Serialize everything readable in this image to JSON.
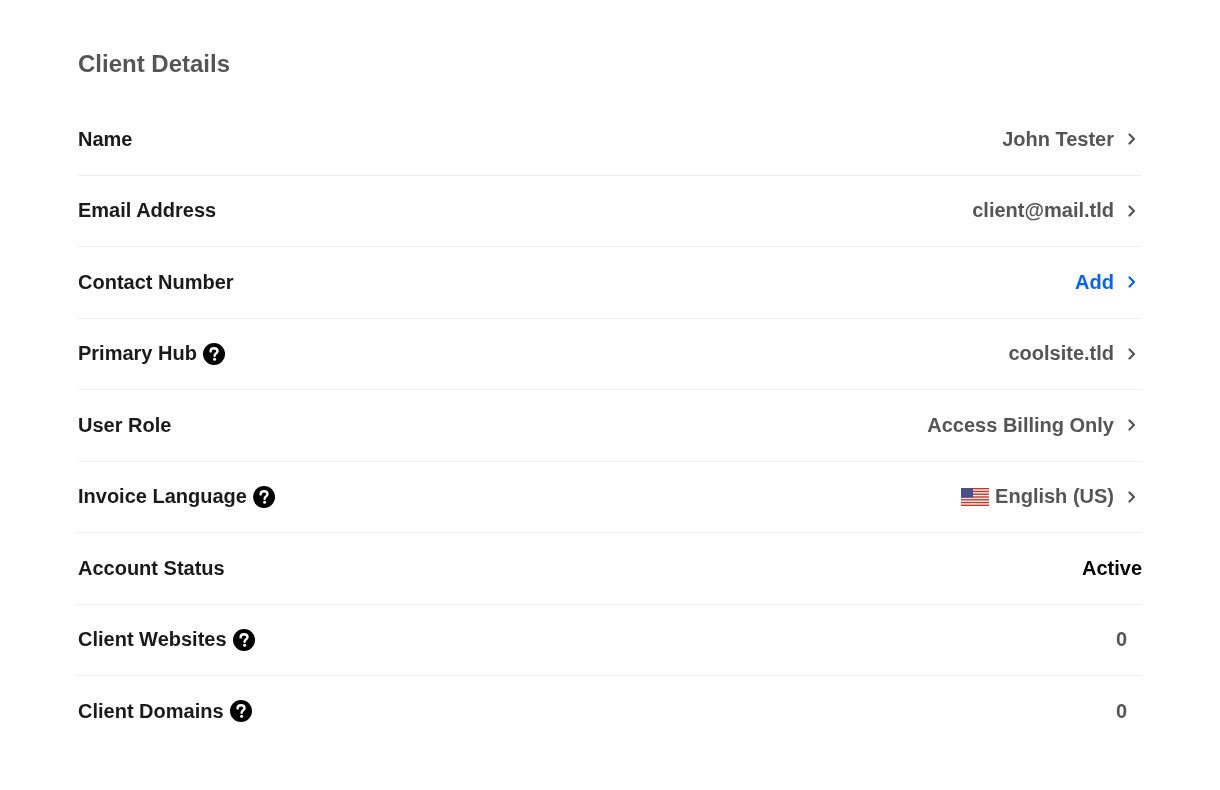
{
  "title": "Client Details",
  "rows": [
    {
      "label": "Name",
      "help": false,
      "value": {
        "kind": "link",
        "text": "John Tester"
      }
    },
    {
      "label": "Email Address",
      "help": false,
      "value": {
        "kind": "link",
        "text": "client@mail.tld"
      }
    },
    {
      "label": "Contact Number",
      "help": false,
      "value": {
        "kind": "action",
        "text": "Add"
      }
    },
    {
      "label": "Primary Hub",
      "help": true,
      "value": {
        "kind": "link",
        "text": "coolsite.tld"
      }
    },
    {
      "label": "User Role",
      "help": false,
      "value": {
        "kind": "link",
        "text": "Access Billing Only"
      }
    },
    {
      "label": "Invoice Language",
      "help": true,
      "value": {
        "kind": "language",
        "text": "English (US)"
      }
    },
    {
      "label": "Account Status",
      "help": false,
      "value": {
        "kind": "status",
        "text": "Active"
      }
    },
    {
      "label": "Client Websites",
      "help": true,
      "value": {
        "kind": "count",
        "text": "0"
      }
    },
    {
      "label": "Client Domains",
      "help": true,
      "value": {
        "kind": "count",
        "text": "0"
      }
    }
  ]
}
